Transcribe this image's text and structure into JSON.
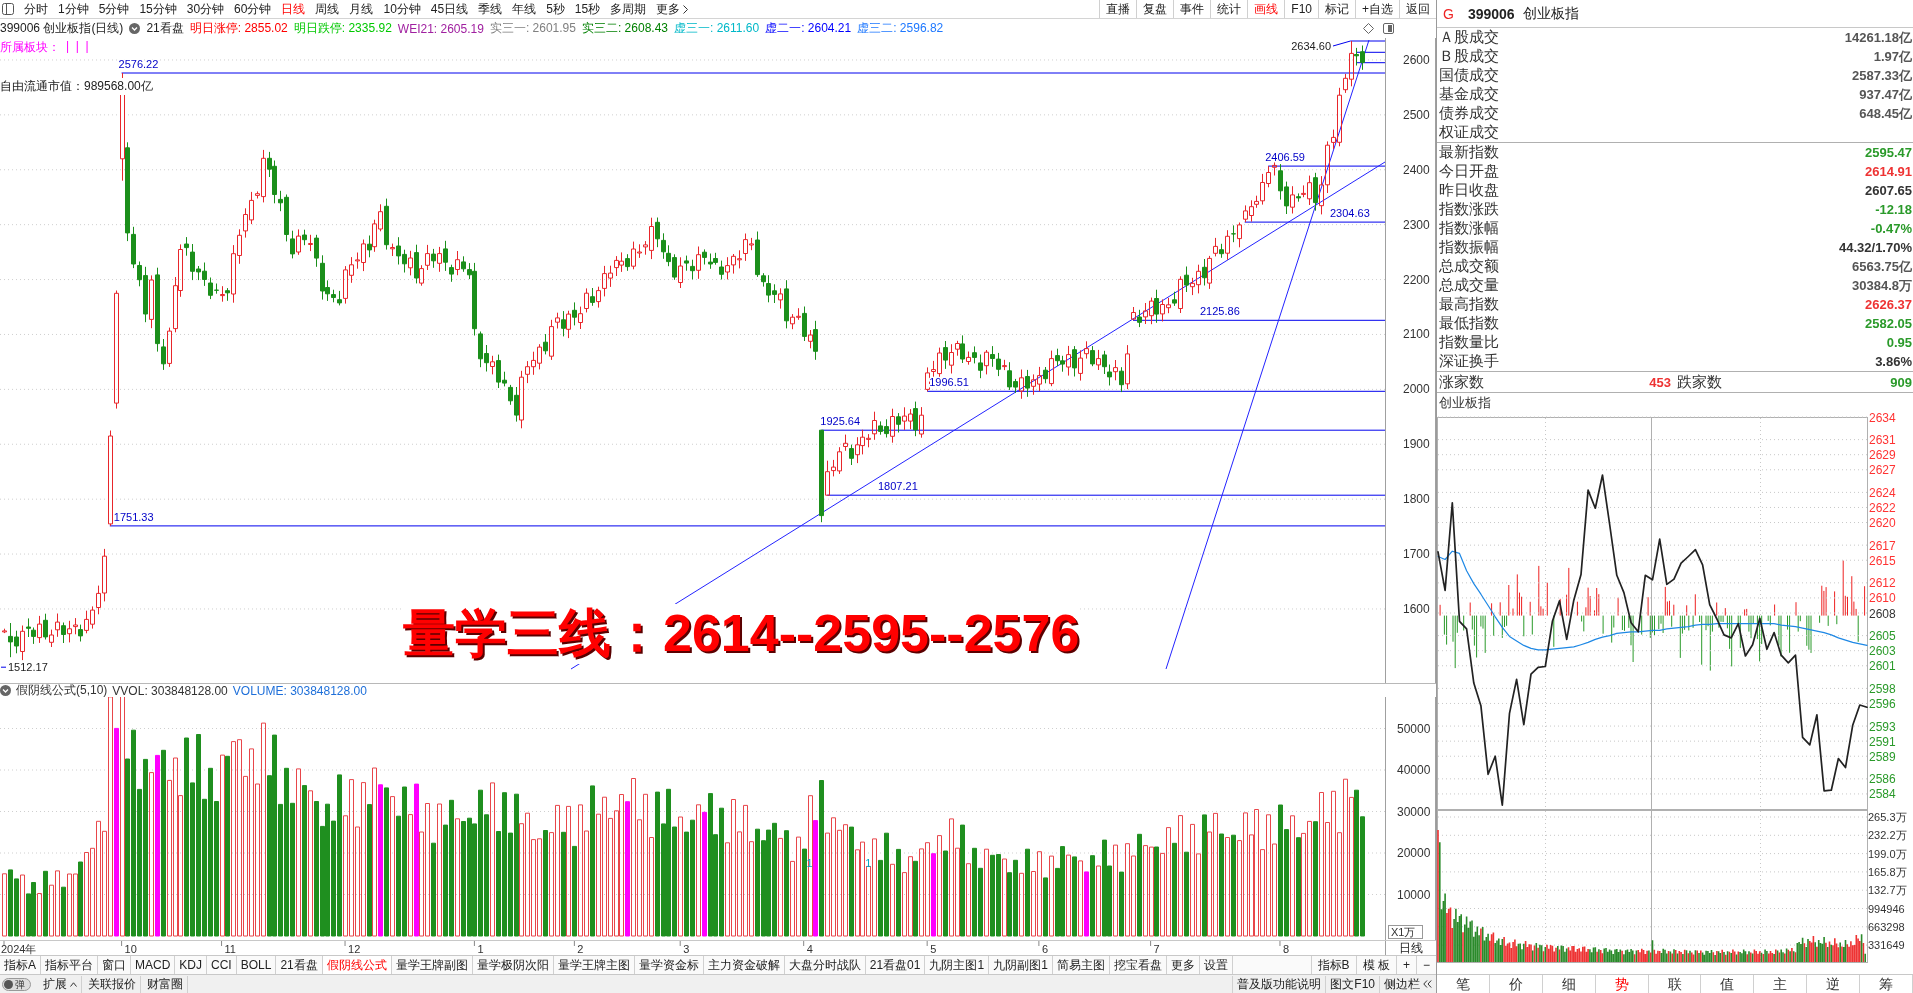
{
  "toolbar": {
    "periods": [
      {
        "label": "分时",
        "selected": false
      },
      {
        "label": "1分钟",
        "selected": false
      },
      {
        "label": "5分钟",
        "selected": false
      },
      {
        "label": "15分钟",
        "selected": false
      },
      {
        "label": "30分钟",
        "selected": false
      },
      {
        "label": "60分钟",
        "selected": false
      },
      {
        "label": "日线",
        "selected": true
      },
      {
        "label": "周线",
        "selected": false
      },
      {
        "label": "月线",
        "selected": false
      },
      {
        "label": "10分钟",
        "selected": false
      },
      {
        "label": "45日线",
        "selected": false
      },
      {
        "label": "季线",
        "selected": false
      },
      {
        "label": "年线",
        "selected": false
      },
      {
        "label": "5秒",
        "selected": false
      },
      {
        "label": "15秒",
        "selected": false
      },
      {
        "label": "多周期",
        "selected": false
      }
    ],
    "more": "更多",
    "actions": [
      {
        "label": "直播",
        "selected": false
      },
      {
        "label": "复盘",
        "selected": false
      },
      {
        "label": "事件",
        "selected": false
      },
      {
        "label": "统计",
        "selected": false
      },
      {
        "label": "画线",
        "selected": true
      },
      {
        "label": "F10",
        "selected": false
      },
      {
        "label": "标记",
        "selected": false
      },
      {
        "label": "+自选",
        "selected": false
      },
      {
        "label": "返回",
        "selected": false
      }
    ]
  },
  "chart_header": {
    "title": "399006 创业板指(日线)",
    "indicator": "21看盘",
    "values": [
      {
        "text": "明日涨停: 2855.02",
        "color": "#ff0000"
      },
      {
        "text": "明日跌停: 2335.92",
        "color": "#00c800"
      },
      {
        "text": "WEI21: 2605.19",
        "color": "#a020a0"
      },
      {
        "text": "实三一: 2601.95",
        "color": "#808080"
      },
      {
        "text": "实三二: 2608.43",
        "color": "#008000"
      },
      {
        "text": "虚三一: 2611.60",
        "color": "#00b8c8"
      },
      {
        "text": "虚二一: 2604.21",
        "color": "#0000ff"
      },
      {
        "text": "虚三二: 2596.82",
        "color": "#1e78ff"
      }
    ]
  },
  "sector": {
    "label": "所属板块：",
    "marks": "|  |  |"
  },
  "market_value": "自由流通市值：989568.00亿",
  "price_chart": {
    "axis_labels": [
      "2600",
      "2500",
      "2400",
      "2300",
      "2200",
      "2100",
      "2000",
      "1900",
      "1800",
      "1700",
      "1600"
    ],
    "annotations": [
      "2576.22",
      "1751.33",
      "1512.17",
      "1925.64",
      "1807.21",
      "1996.51",
      "2125.86",
      "2304.63",
      "2406.59",
      "2634.60"
    ],
    "headline": "量学三线：2614--2595--2576"
  },
  "volume_panel": {
    "title": "假阴线公式(5,10)",
    "values": [
      {
        "text": "VVOL: 303848128.00",
        "color": "#333333"
      },
      {
        "text": "VOLUME: 303848128.00",
        "color": "#1e6fd9"
      }
    ],
    "marks": [
      "1",
      "1"
    ],
    "axis_labels": [
      "50000",
      "40000",
      "30000",
      "20000",
      "10000"
    ],
    "unit": "X1万"
  },
  "date_axis": {
    "labels": [
      "2024年",
      "10",
      "11",
      "12",
      "1",
      "2",
      "3",
      "4",
      "5",
      "6",
      "7",
      "8"
    ],
    "period": "日线"
  },
  "indicator_tabs": [
    {
      "label": "指标A",
      "selected": false
    },
    {
      "label": "指标平台",
      "selected": false
    },
    {
      "label": "窗口",
      "selected": false
    },
    {
      "label": "MACD",
      "selected": false
    },
    {
      "label": "KDJ",
      "selected": false
    },
    {
      "label": "CCI",
      "selected": false
    },
    {
      "label": "BOLL",
      "selected": false
    },
    {
      "label": "21看盘",
      "selected": false
    },
    {
      "label": "假阴线公式",
      "selected": true
    },
    {
      "label": "量学王牌副图",
      "selected": false
    },
    {
      "label": "量学极阴次阳",
      "selected": false
    },
    {
      "label": "量学王牌主图",
      "selected": false
    },
    {
      "label": "量学资金标",
      "selected": false
    },
    {
      "label": "主力资金破解",
      "selected": false
    },
    {
      "label": "大盘分时战队",
      "selected": false
    },
    {
      "label": "21看盘01",
      "selected": false
    },
    {
      "label": "九阴主图1",
      "selected": false
    },
    {
      "label": "九阴副图1",
      "selected": false
    },
    {
      "label": "简易主图",
      "selected": false
    },
    {
      "label": "挖宝看盘",
      "selected": false
    },
    {
      "label": "更多",
      "selected": false
    },
    {
      "label": "设置",
      "selected": false
    }
  ],
  "indicator_tools": [
    "指标B",
    "模 板",
    "+",
    "−"
  ],
  "footer": {
    "toggle": {
      "label": "弹",
      "on": false
    },
    "expand": "扩展",
    "links": [
      "关联报价",
      "财富圈"
    ],
    "right_links": [
      "普及版功能说明",
      "图文F10"
    ],
    "sidebar": "侧边栏"
  },
  "quote_panel": {
    "market_mark": "G",
    "code": "399006",
    "name": "创业板指",
    "trade_rows": [
      {
        "label": "Ａ股成交",
        "value": "14261.18亿"
      },
      {
        "label": "Ｂ股成交",
        "value": "1.97亿"
      },
      {
        "label": "国债成交",
        "value": "2587.33亿"
      },
      {
        "label": "基金成交",
        "value": "937.47亿"
      },
      {
        "label": "债券成交",
        "value": "648.45亿"
      },
      {
        "label": "权证成交"
      }
    ],
    "index_rows": [
      {
        "label": "最新指数",
        "value": "2595.47",
        "color": "#2a9a2a"
      },
      {
        "label": "今日开盘",
        "value": "2614.91",
        "color": "#ee3333"
      },
      {
        "label": "昨日收盘",
        "value": "2607.65",
        "color": "#333333"
      },
      {
        "label": "指数涨跌",
        "value": "-12.18",
        "color": "#2a9a2a"
      },
      {
        "label": "指数涨幅",
        "value": "-0.47%",
        "color": "#2a9a2a"
      },
      {
        "label": "指数振幅",
        "value": "44.32/1.70%",
        "color": "#333333"
      },
      {
        "label": "总成交额",
        "value": "6563.75亿",
        "color": "#555555"
      },
      {
        "label": "总成交量",
        "value": "30384.8万",
        "color": "#555555"
      },
      {
        "label": "最高指数",
        "value": "2626.37",
        "color": "#ee3333"
      },
      {
        "label": "最低指数",
        "value": "2582.05",
        "color": "#2a9a2a"
      },
      {
        "label": "指数量比",
        "value": "0.95",
        "color": "#2a9a2a"
      },
      {
        "label": "深证换手",
        "value": "3.86%",
        "color": "#333333"
      }
    ],
    "breadth": {
      "up_label": "涨家数",
      "up_count": "453",
      "down_label": "跌家数",
      "down_count": "909"
    }
  },
  "intraday": {
    "title": "创业板指",
    "volume_labels": [
      "265.3万",
      "232.2万",
      "199.0万",
      "165.8万",
      "132.7万",
      "994946",
      "663298",
      "331649"
    ],
    "chart_data": {
      "type": "line",
      "categories": [
        null,
        null,
        null,
        null,
        null,
        null,
        null,
        null,
        null,
        null,
        null,
        null,
        null,
        null,
        null,
        null,
        null,
        null,
        null,
        null,
        null,
        null,
        null,
        null,
        null,
        null,
        null,
        null,
        null,
        null,
        null,
        null,
        null,
        null,
        null,
        null,
        null,
        null,
        null,
        null,
        null,
        null,
        null,
        null,
        null,
        null,
        null,
        null,
        null,
        null,
        null,
        null,
        null,
        null,
        null,
        null,
        null,
        null,
        null,
        null,
        null
      ],
      "ylim": [
        2582,
        2634
      ],
      "grid": true,
      "yticks": [
        2634,
        2631,
        2629,
        2627,
        2624,
        2622,
        2620,
        2617,
        2615,
        2612,
        2610,
        2608,
        2605,
        2603,
        2601,
        2598,
        2596,
        2593,
        2591,
        2589,
        2586,
        2584
      ],
      "series": [
        {
          "color": "#222222",
          "values": [
            2616.1,
            2611.0,
            2622.6,
            2606.9,
            2605.9,
            2598.7,
            2595.7,
            2586.6,
            2589.0,
            2582.5,
            2594.7,
            2599.2,
            2593.2,
            2599.9,
            2600.8,
            2600.9,
            2606.9,
            2609.6,
            2604.5,
            2609.7,
            2613.1,
            2624.3,
            2621.9,
            2626.3,
            2619.8,
            2613.0,
            2610.7,
            2606.7,
            2605.5,
            2613.0,
            2612.4,
            2617.8,
            2611.8,
            2612.5,
            2614.6,
            2615.5,
            2616.4,
            2614.4,
            2609.1,
            2607.2,
            2605.1,
            2604.7,
            2606.6,
            2602.3,
            2603.8,
            2607.3,
            2603.2,
            2605.4,
            2602.4,
            2601.4,
            2602.4,
            2591.5,
            2590.5,
            2594.5,
            2584.4,
            2584.5,
            2588.7,
            2587.5,
            2593.1,
            2595.8,
            2595.5
          ]
        },
        {
          "color": "#1e88e5",
          "values": [
            2615.5,
            2615.1,
            2616.2,
            2615.9,
            2613.6,
            2611.9,
            2610.5,
            2609.0,
            2607.5,
            2606.1,
            2604.9,
            2604.3,
            2603.7,
            2603.3,
            2603.1,
            2603.1,
            2603.2,
            2603.3,
            2603.4,
            2603.5,
            2603.8,
            2604.1,
            2604.5,
            2604.8,
            2605.0,
            2605.3,
            2605.4,
            2605.5,
            2605.5,
            2605.6,
            2605.7,
            2605.7,
            2605.9,
            2606.0,
            2606.1,
            2606.2,
            2606.4,
            2606.5,
            2606.5,
            2606.6,
            2606.6,
            2606.6,
            2606.6,
            2606.6,
            2606.6,
            2606.6,
            2606.6,
            2606.6,
            2606.4,
            2606.3,
            2606.2,
            2606.0,
            2605.8,
            2605.6,
            2605.4,
            2605.1,
            2604.7,
            2604.4,
            2604.1,
            2603.9,
            2603.7
          ]
        }
      ]
    }
  },
  "intraday_tabs": [
    {
      "label": "笔",
      "selected": false
    },
    {
      "label": "价",
      "selected": false
    },
    {
      "label": "细",
      "selected": false
    },
    {
      "label": "势",
      "selected": true
    },
    {
      "label": "联",
      "selected": false
    },
    {
      "label": "值",
      "selected": false
    },
    {
      "label": "主",
      "selected": false
    },
    {
      "label": "逆",
      "selected": false
    },
    {
      "label": "筹",
      "selected": false
    }
  ]
}
